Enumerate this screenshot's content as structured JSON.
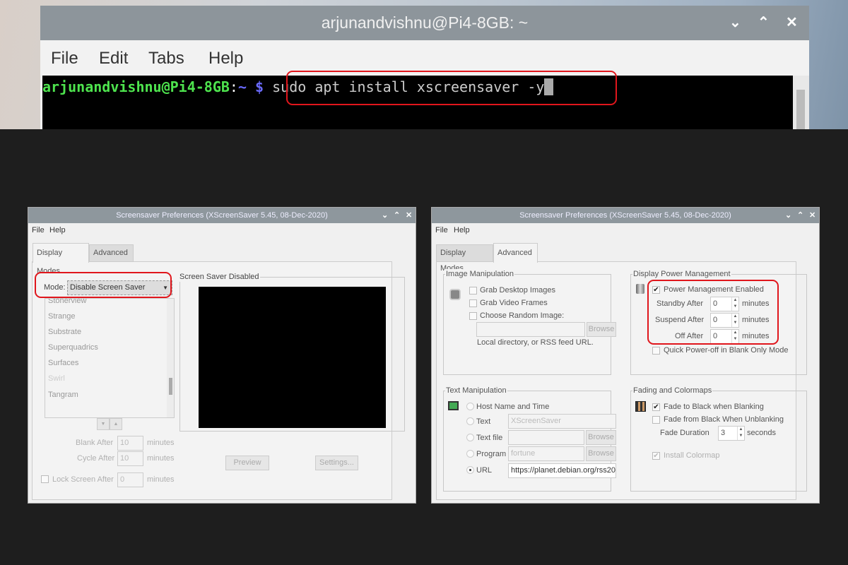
{
  "terminal": {
    "title": "arjunandvishnu@Pi4-8GB: ~",
    "controls": [
      "⌄",
      "⌃",
      "✕"
    ],
    "menu": [
      "File",
      "Edit",
      "Tabs",
      "Help"
    ],
    "prompt_user": "arjunandvishnu@Pi4-8GB",
    "prompt_colon": ":",
    "prompt_dir": "~",
    "prompt_symbol": "$",
    "command": "sudo apt install xscreensaver -y"
  },
  "dialog_title": "Screensaver Preferences  (XScreenSaver 5.45, 08-Dec-2020)",
  "dialog_controls": [
    "⌄",
    "⌃",
    "✕"
  ],
  "menu": [
    "File",
    "Help"
  ],
  "tabs": [
    "Display Modes",
    "Advanced"
  ],
  "display_modes": {
    "mode_label": "Mode:",
    "mode_value": "Disable Screen Saver",
    "list": [
      "Stonerview",
      "Strange",
      "Substrate",
      "Superquadrics",
      "Surfaces",
      "Swirl",
      "Tangram"
    ],
    "preview_title": "Screen Saver Disabled",
    "blank_label": "Blank After",
    "blank_value": "10",
    "cycle_label": "Cycle After",
    "cycle_value": "10",
    "lock_label": "Lock Screen After",
    "lock_value": "0",
    "minutes": "minutes",
    "preview_btn": "Preview",
    "settings_btn": "Settings..."
  },
  "advanced": {
    "image": {
      "title": "Image Manipulation",
      "grab_desktop": "Grab Desktop Images",
      "grab_video": "Grab Video Frames",
      "random": "Choose Random Image:",
      "browse": "Browse",
      "hint": "Local directory, or RSS feed URL."
    },
    "power": {
      "title": "Display Power Management",
      "enabled": "Power Management Enabled",
      "standby_label": "Standby After",
      "standby": "0",
      "suspend_label": "Suspend After",
      "suspend": "0",
      "off_label": "Off After",
      "off": "0",
      "minutes": "minutes",
      "quick": "Quick Power-off in Blank Only Mode"
    },
    "text": {
      "title": "Text Manipulation",
      "host": "Host Name and Time",
      "text_label": "Text",
      "text_value": "XScreenSaver",
      "file_label": "Text file",
      "program_label": "Program",
      "program_value": "fortune",
      "url_label": "URL",
      "url_value": "https://planet.debian.org/rss20",
      "browse": "Browse"
    },
    "fading": {
      "title": "Fading and Colormaps",
      "fade_to": "Fade to Black when Blanking",
      "fade_from": "Fade from Black When Unblanking",
      "duration_label": "Fade Duration",
      "duration": "3",
      "seconds": "seconds",
      "colormap": "Install Colormap"
    }
  },
  "colors": {
    "highlight": "#e0161c",
    "prompt_green": "#4ee44e",
    "prompt_blue": "#6b6bff"
  }
}
